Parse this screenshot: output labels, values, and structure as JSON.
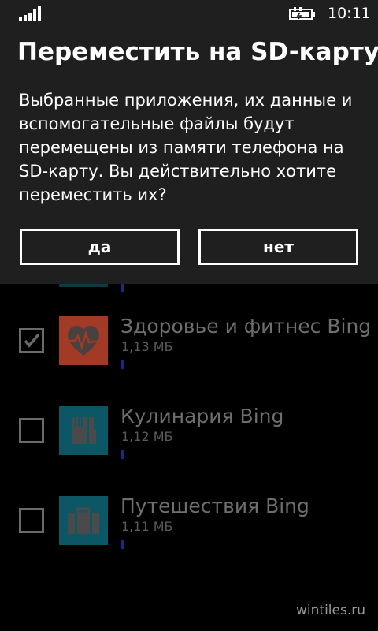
{
  "status_bar": {
    "time": "10:11",
    "signal_icon": "signal-strength-icon",
    "battery_icon": "battery-charging-icon"
  },
  "dialog": {
    "title": "Переместить на SD-карту?",
    "message": "Выбранные приложения, их данные и вспомогательные файлы будут перемещены из памяти телефона на SD-карту. Вы действительно хотите переместить их?",
    "yes_label": "да",
    "no_label": "нет"
  },
  "app_list": {
    "items": [
      {
        "name": "Здоровье и фитнес Bing",
        "size": "1,13 МБ",
        "checked": true,
        "icon": "heart-pulse-icon",
        "tile_color": "#a33a25"
      },
      {
        "name": "Кулинария Bing",
        "size": "1,12 МБ",
        "checked": false,
        "icon": "fork-knife-icon",
        "tile_color": "#0c5666"
      },
      {
        "name": "Путешествия Bing",
        "size": "1,11 МБ",
        "checked": false,
        "icon": "suitcase-icon",
        "tile_color": "#0c5666"
      }
    ]
  },
  "watermark": "wintiles.ru",
  "colors": {
    "dialog_bg": "#1f1f1f",
    "page_bg": "#000000",
    "progress_accent": "#1a2a80"
  }
}
